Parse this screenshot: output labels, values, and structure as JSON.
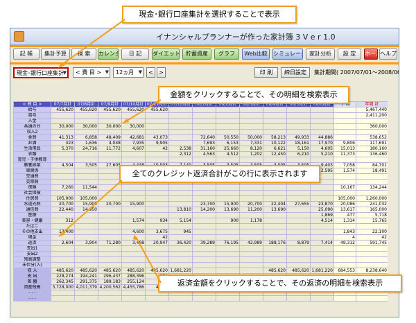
{
  "window": {
    "title": "イナンシャルプランナーが作った家計簿 3  V e r 1.0"
  },
  "toolbar": {
    "buttons": [
      "記 帳",
      "集計予算",
      "検 索",
      "カレンダー",
      "日 記",
      "ダイエット",
      "貯蓄資産",
      "グラフ",
      "Web比較",
      "シミュレーション",
      "家計分析",
      "設 定",
      "ホームページ",
      "ヘルプ"
    ]
  },
  "controls": {
    "account_select": "現金･銀行口座集計",
    "item_select": "< 費 目 >",
    "month_select": "12ヵ月",
    "prev": "<",
    "next": ">",
    "print": "印 刷",
    "fiscal_setting": "締日設定",
    "period": "集計期間( 2007/07/01～2008/06/30 )"
  },
  "grid": {
    "headers": [
      "< 費 目 >",
      "07/7月計",
      "07/8月計",
      "07/9月計",
      "07/10月計",
      "07/11月計",
      "07/12月計",
      "08/1月計",
      "08/2月計",
      "08/3月計",
      "08/4月計",
      "08/5月計",
      "08/6月計",
      "平 均",
      "年間 計"
    ],
    "rows": [
      [
        "給与",
        "455,620",
        "455,620",
        "455,620",
        "455,620",
        "455,620",
        "",
        "",
        "",
        "",
        "",
        "",
        "",
        "",
        "5,467,440"
      ],
      [
        "賞与",
        "",
        "",
        "",
        "",
        "",
        "",
        "",
        "",
        "",
        "",
        "",
        "",
        "",
        "2,411,200"
      ],
      [
        "入金",
        "",
        "",
        "",
        "",
        "",
        "",
        "",
        "",
        "",
        "",
        "",
        "",
        "",
        ""
      ],
      [
        "共通の分",
        "30,000",
        "30,000",
        "30,000",
        "30,000",
        "",
        "",
        "",
        "",
        "",
        "",
        "",
        "",
        "",
        "360,000"
      ],
      [
        "収入2",
        "",
        "",
        "",
        "",
        "",
        "",
        "",
        "",
        "",
        "",
        "",
        "",
        "",
        ""
      ],
      [
        "食費",
        "41,313",
        "6,858",
        "48,409",
        "42,681",
        "43,073",
        "",
        "72,640",
        "50,550",
        "50,000",
        "58,213",
        "49,933",
        "44,886",
        "",
        "538,652"
      ],
      [
        "お酒",
        "323",
        "1,636",
        "4,048",
        "7,935",
        "9,905",
        "",
        "7,693",
        "6,153",
        "7,331",
        "10,122",
        "18,161",
        "17,970",
        "9,806",
        "117,691"
      ],
      [
        "生活用品",
        "5,370",
        "24,716",
        "11,772",
        "4,607",
        "42",
        "2,538",
        "31,160",
        "25,660",
        "8,120",
        "6,621",
        "5,150",
        "4,605",
        "15,013",
        "180,160"
      ],
      [
        "衣類",
        "",
        "",
        "",
        "",
        "",
        "2,312",
        "4,563",
        "4,512",
        "1,202",
        "12,450",
        "6,210",
        "5,210",
        "11,373",
        "136,460"
      ],
      [
        "育児・子供教育",
        "",
        "",
        "",
        "",
        "",
        "",
        "",
        "",
        "",
        "",
        "",
        "",
        "",
        ""
      ],
      [
        "教養娯楽",
        "4,504",
        "3,505",
        "27,605",
        "4,448",
        "10,503",
        "7,140",
        "3,505",
        "3,505",
        "3,505",
        "3,505",
        "3,505",
        "9,403",
        "7,058",
        "84,701"
      ],
      [
        "車関係",
        "",
        "",
        "",
        "",
        "2,648",
        "",
        "5,505",
        "",
        "",
        "",
        "",
        "2,595",
        "1,574",
        "18,491"
      ],
      [
        "交通費",
        "",
        "",
        "",
        "",
        "",
        "",
        "",
        "",
        "",
        "",
        "",
        "",
        "",
        ""
      ],
      [
        "交際費",
        "",
        "",
        "",
        "",
        "",
        "",
        "",
        "",
        "",
        "",
        "",
        "",
        "",
        ""
      ],
      [
        "保険",
        "7,260",
        "11,544",
        "",
        "",
        "",
        "",
        "",
        "",
        "",
        "",
        "",
        "",
        "10,167",
        "134,244"
      ],
      [
        "社会保険",
        "",
        "",
        "",
        "",
        "",
        "",
        "",
        "",
        "",
        "",
        "",
        "",
        "",
        ""
      ],
      [
        "住居費",
        "105,000",
        "105,000",
        "",
        "",
        "",
        "",
        "",
        "",
        "",
        "",
        "",
        "",
        "105,000",
        "1,260,000"
      ],
      [
        "水道光熱",
        "20,700",
        "15,900",
        "20,700",
        "15,900",
        "",
        "",
        "23,700",
        "15,900",
        "20,700",
        "22,404",
        "27,655",
        "23,870",
        "20,086",
        "241,032"
      ],
      [
        "通信費",
        "22,440",
        "14,950",
        "",
        "",
        "",
        "13,810",
        "14,200",
        "13,690",
        "11,200",
        "13,690",
        "",
        "25,090",
        "13,617",
        "165,000"
      ],
      [
        "医療",
        "",
        "",
        "",
        "",
        "",
        "",
        "",
        "",
        "",
        "",
        "",
        "1,869",
        "477",
        "5,718"
      ],
      [
        "美容・健康",
        "312",
        "",
        "",
        "1,574",
        "934",
        "5,154",
        "",
        "900",
        "1,178",
        "",
        "",
        "4,514",
        "1,314",
        "15,765"
      ],
      [
        "たばこ",
        "",
        "",
        "",
        "",
        "",
        "",
        "",
        "",
        "",
        "",
        "",
        "",
        "",
        ""
      ],
      [
        "その他支出",
        "13,400",
        "",
        "",
        "4,600",
        "3,675",
        "945",
        "",
        "",
        "",
        "",
        "",
        "",
        "1,843",
        "22,100"
      ],
      [
        "現金",
        "",
        "",
        "",
        "",
        "42",
        "",
        "",
        "",
        "",
        "",
        "",
        "",
        "4",
        "42"
      ],
      [
        "返済",
        "2,604",
        "3,904",
        "71,280",
        "3,468",
        "20,947",
        "36,420",
        "39,289",
        "76,195",
        "42,989",
        "188,176",
        "8,879",
        "7,414",
        "49,312",
        "591,745"
      ],
      [
        "支出1",
        "",
        "",
        "",
        "",
        "",
        "",
        "",
        "",
        "",
        "",
        "",
        "",
        "",
        ""
      ],
      [
        "支出2",
        "",
        "",
        "",
        "",
        "",
        "",
        "",
        "",
        "",
        "",
        "",
        "",
        "",
        ""
      ],
      [
        "残高調整",
        "",
        "",
        "",
        "",
        "",
        "",
        "",
        "",
        "",
        "",
        "",
        "",
        "",
        ""
      ],
      [
        "未仕分(入)",
        "",
        "",
        "",
        "",
        "",
        "",
        "",
        "",
        "",
        "",
        "",
        "",
        "",
        ""
      ],
      [
        "収 入",
        "485,620",
        "485,620",
        "485,620",
        "485,620",
        "485,620",
        "1,681,220",
        "",
        "",
        "",
        "485,620",
        "485,620",
        "1,681,220",
        "684,553",
        "8,238,640"
      ],
      [
        "支 出",
        "228,274",
        "194,241",
        "296,437",
        "288,396",
        "374",
        "",
        "",
        "",
        "",
        "",
        "",
        "",
        "",
        ""
      ],
      [
        "差 額",
        "262,345",
        "291,375",
        "189,183",
        "255,124",
        "11",
        "",
        "",
        "",
        "",
        "",
        "",
        "",
        "",
        ""
      ],
      [
        "資産残高",
        "3,728,000",
        "4,011,379",
        "4,200,562",
        "4,455,786",
        "4,567",
        "",
        "",
        "",
        "",
        "",
        "",
        "",
        "",
        ""
      ],
      [
        "- - -",
        "",
        "",
        "",
        "",
        "",
        "",
        "",
        "",
        "",
        "",
        "",
        "",
        "",
        ""
      ],
      [
        "- - -",
        "",
        "",
        "",
        "",
        "",
        "",
        "",
        "",
        "",
        "",
        "",
        "",
        "",
        ""
      ]
    ]
  },
  "callouts": {
    "c1": "現金･銀行口座集計を選択することで表示",
    "c2": "金額をクリックすることで、その明細を検索表示",
    "c3": "全てのクレジット返済合計がこの行に表示されます",
    "c4": "返済金額をクリックすることで、その返済の明細を検索表示"
  },
  "colors": {
    "accent_orange": "#ff9c00",
    "header_blue": "#4f52b8",
    "category_lavender": "#c9c9f2",
    "callout_border": "#f0a020"
  }
}
